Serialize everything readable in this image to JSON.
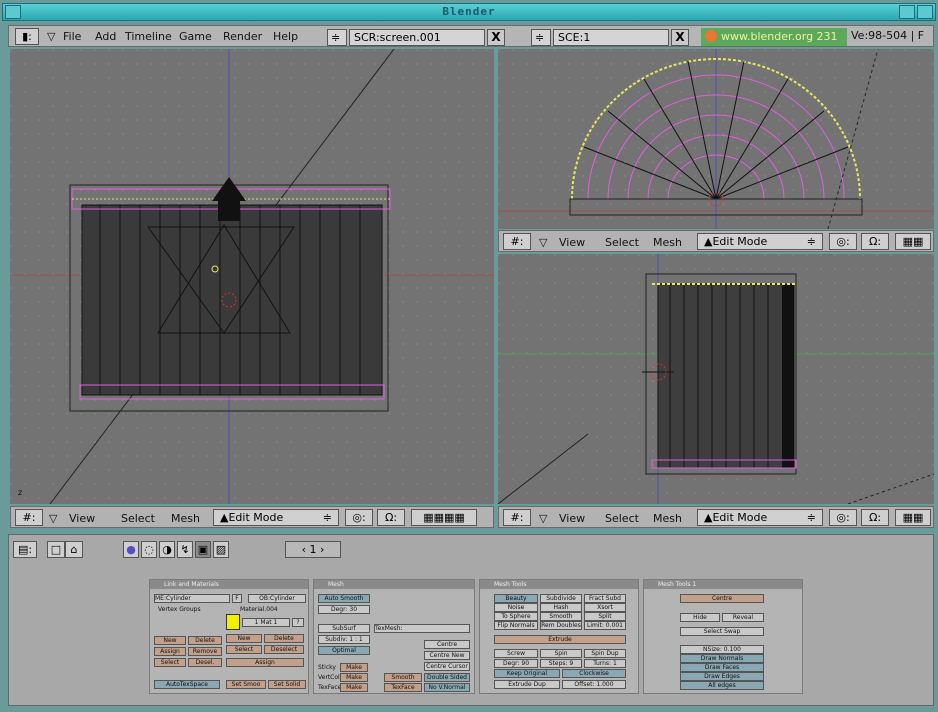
{
  "window": {
    "title": "Blender"
  },
  "menu": {
    "items": [
      "File",
      "Add",
      "Timeline",
      "Game",
      "Render",
      "Help"
    ],
    "screen_field": "SCR:screen.001",
    "scene_field": "SCE:1",
    "close_glyph": "X",
    "info": "www.blender.org 231",
    "version": "Ve:98-504 | F"
  },
  "viewport_header": {
    "view": "View",
    "select": "Select",
    "mesh": "Mesh",
    "mode": "Edit Mode"
  },
  "bottom_header": {
    "frame": "1"
  },
  "panels": {
    "link": {
      "title": "Link and Materials",
      "me": "ME:Cylinder",
      "f": "F",
      "ob": "OB:Cylinder",
      "vertex_groups": "Vertex Groups",
      "material": "Material.004",
      "mat_count": "1 Mat 1",
      "q": "?",
      "new1": "New",
      "delete1": "Delete",
      "new2": "New",
      "delete2": "Delete",
      "assign1": "Assign",
      "remove": "Remove",
      "select1": "Select",
      "deselect1": "Desel.",
      "select2": "Select",
      "deselect2": "Deselect",
      "assign2": "Assign",
      "autotexspace": "AutoTexSpace",
      "set_smooth": "Set Smoo",
      "set_solid": "Set Solid"
    },
    "mesh": {
      "title": "Mesh",
      "auto_smooth": "Auto Smooth",
      "degr": "Degr: 30",
      "subsurf": "SubSurf",
      "subdiv": "Subdiv: 1 : 1",
      "optimal": "Optimal",
      "texmesh": "TexMesh:",
      "centre": "Centre",
      "centre_new": "Centre New",
      "centre_cursor": "Centre Cursor",
      "sticky": "Sticky",
      "vertcol": "VertCol",
      "texface": "TexFace",
      "make1": "Make",
      "make2": "Make",
      "make3": "Make",
      "double_sided": "Double Sided",
      "no_v_normal": "No V.Normal",
      "smooth": "Smooth",
      "tex_face": "TexFace"
    },
    "tools": {
      "title": "Mesh Tools",
      "beauty": "Beauty",
      "subdivide": "Subdivide",
      "fract_subd": "Fract Subd",
      "noise": "Noise",
      "hash": "Hash",
      "xsort": "Xsort",
      "to_sphere": "To Sphere",
      "smooth": "Smooth",
      "split": "Split",
      "flip_normals": "Flip Normals",
      "rem_doubles": "Rem Doubles",
      "limit": "Limit: 0.001",
      "extrude": "Extrude",
      "screw": "Screw",
      "spin": "Spin",
      "spin_dup": "Spin Dup",
      "degr": "Degr: 90",
      "steps": "Steps: 9",
      "turns": "Turns: 1",
      "keep_original": "Keep Original",
      "clockwise": "Clockwise",
      "extrude_dup": "Extrude Dup",
      "offset": "Offset: 1.000"
    },
    "tools1": {
      "title": "Mesh Tools 1",
      "centre": "Centre",
      "hide": "Hide",
      "reveal": "Reveal",
      "select_swap": "Select Swap",
      "nsize": "NSize: 0.100",
      "draw_normals": "Draw Normals",
      "draw_faces": "Draw Faces",
      "draw_edges": "Draw Edges",
      "all_edges": "All edges"
    }
  },
  "colors": {
    "viewport_bg": "#737373",
    "header_bg": "#b2b2b2",
    "titlebar": "#2aa6b0",
    "selected_vertex": "#e8e860",
    "edge_pink": "#e060e0"
  }
}
